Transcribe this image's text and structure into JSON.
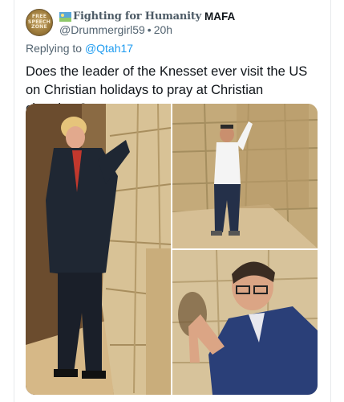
{
  "tweet": {
    "avatar_text": [
      "FREE",
      "SPEECH",
      "ZONE"
    ],
    "display_name": "Fighting for Humanity",
    "name_suffix": "MAFA",
    "handle": "@Drummergirl59",
    "separator": "•",
    "time": "20h",
    "reply_prefix": "Replying to",
    "reply_mention": "@Qtah17",
    "text": "Does the leader of the Knesset ever visit the US on Christian holidays to pray at Christian churches?"
  },
  "icons": {
    "avatar": "free-speech-zone-avatar",
    "flag": "flag-emoji-icon"
  },
  "photos": [
    {
      "name": "photo-man-blue-suit-at-western-wall"
    },
    {
      "name": "photo-man-white-shirt-at-western-wall"
    },
    {
      "name": "photo-man-glasses-at-western-wall"
    }
  ],
  "colors": {
    "text": "#0f1419",
    "muted": "#536471",
    "link": "#1d9bf0",
    "wall": "#c9b07e"
  }
}
